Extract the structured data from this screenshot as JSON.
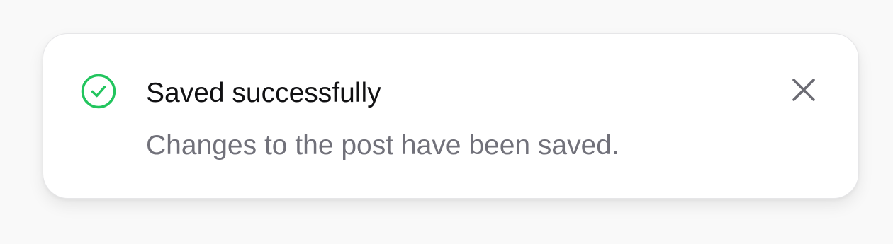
{
  "toast": {
    "status": "success",
    "icon": "check-circle-icon",
    "title": "Saved successfully",
    "description": "Changes to the post have been saved.",
    "close_icon": "close-icon",
    "colors": {
      "success": "#22c55e",
      "title": "#111113",
      "description": "#71717a",
      "close": "#6b6b73",
      "background": "#ffffff",
      "page_background": "#f9f9f9"
    }
  }
}
